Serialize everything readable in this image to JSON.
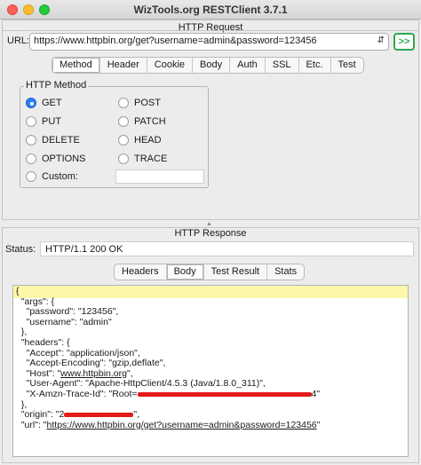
{
  "window": {
    "title": "WizTools.org RESTClient 3.7.1"
  },
  "request": {
    "title": "HTTP Request",
    "url_label": "URL:",
    "url_value": "https://www.httpbin.org/get?username=admin&password=123456",
    "go_label": ">>",
    "tabs": [
      "Method",
      "Header",
      "Cookie",
      "Body",
      "Auth",
      "SSL",
      "Etc.",
      "Test"
    ],
    "active_tab": "Method",
    "method_group": "HTTP Method",
    "methods": {
      "get": "GET",
      "post": "POST",
      "put": "PUT",
      "patch": "PATCH",
      "delete": "DELETE",
      "head": "HEAD",
      "options": "OPTIONS",
      "trace": "TRACE",
      "custom": "Custom:"
    },
    "selected_method": "GET"
  },
  "response": {
    "title": "HTTP Response",
    "status_label": "Status:",
    "status_value": "HTTP/1.1 200 OK",
    "tabs": [
      "Headers",
      "Body",
      "Test Result",
      "Stats"
    ],
    "active_tab": "Body",
    "body": {
      "l1": "{",
      "l2": "  \"args\": {",
      "l3": "    \"password\": \"123456\",",
      "l4": "    \"username\": \"admin\"",
      "l5": "  },",
      "l6": "  \"headers\": {",
      "l7": "    \"Accept\": \"application/json\",",
      "l8": "    \"Accept-Encoding\": \"gzip,deflate\",",
      "l9_pre": "    \"Host\": \"",
      "l9_link": "www.httpbin.org",
      "l9_post": "\",",
      "l10": "    \"User-Agent\": \"Apache-HttpClient/4.5.3 (Java/1.8.0_311)\",",
      "l11_pre": "    \"X-Amzn-Trace-Id\": \"Root=",
      "l11_post": "4\"",
      "l12": "  },",
      "l13_pre": "  \"origin\": \"2",
      "l13_post": "\",",
      "l14_pre": "  \"url\": \"",
      "l14_link": "https://www.httpbin.org/get?username=admin&password=123456",
      "l14_post": "\""
    }
  },
  "colors": {
    "accent": "#2b7cf5",
    "go_button": "#2fa84f",
    "highlight": "#fbf8a8",
    "redaction": "#e31b1b"
  }
}
